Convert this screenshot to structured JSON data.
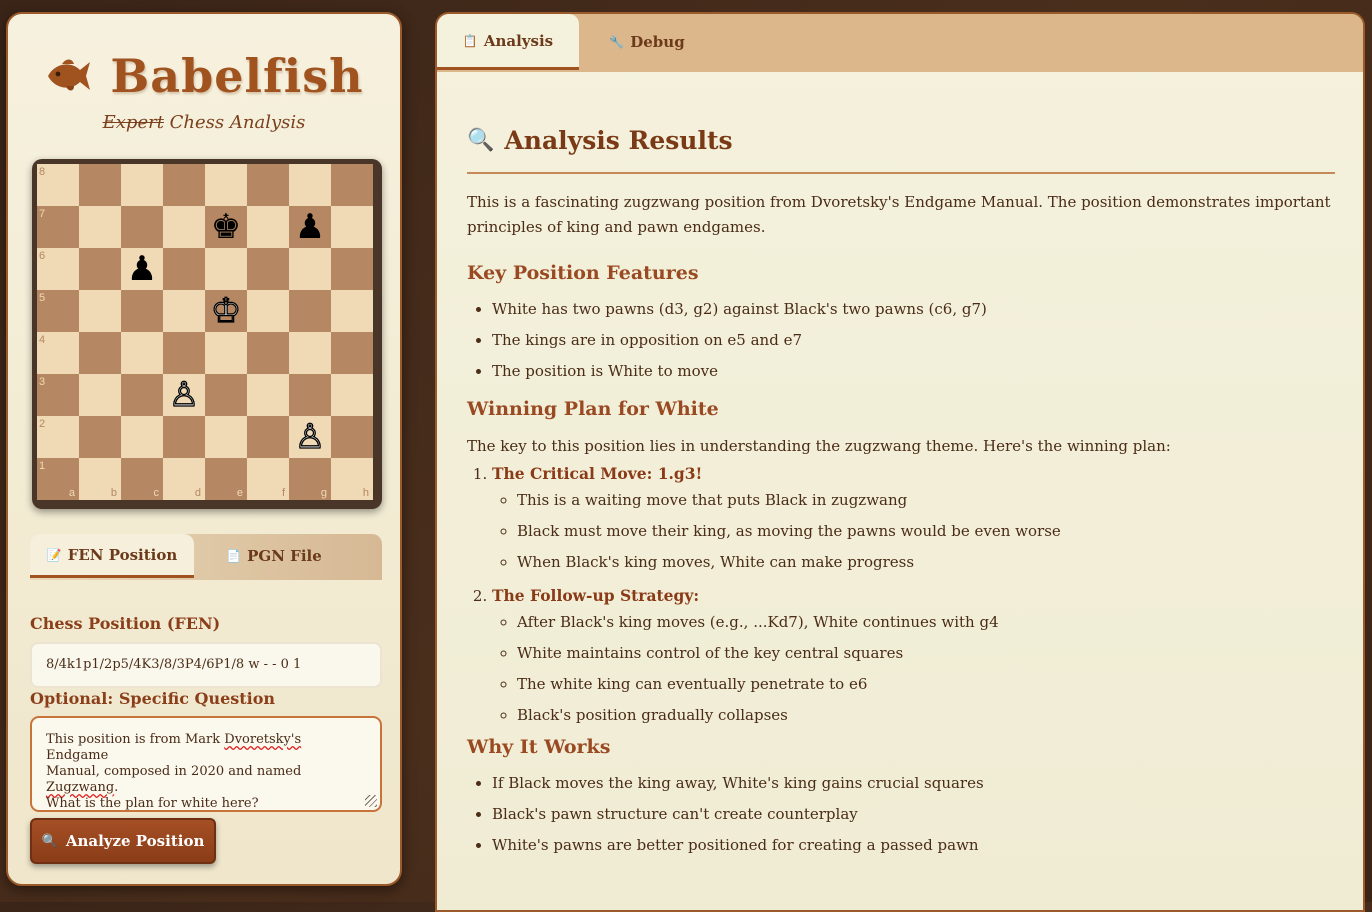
{
  "brand": {
    "title": "Babelfish",
    "subtitle_strike": "Expert",
    "subtitle_rest": " Chess Analysis"
  },
  "board": {
    "files": [
      "a",
      "b",
      "c",
      "d",
      "e",
      "f",
      "g",
      "h"
    ],
    "ranks": [
      "8",
      "7",
      "6",
      "5",
      "4",
      "3",
      "2",
      "1"
    ],
    "pieces": [
      {
        "square": "e7",
        "glyph": "♚",
        "color": "black"
      },
      {
        "square": "g7",
        "glyph": "♟",
        "color": "black"
      },
      {
        "square": "c6",
        "glyph": "♟",
        "color": "black"
      },
      {
        "square": "e5",
        "glyph": "♔",
        "color": "white"
      },
      {
        "square": "d3",
        "glyph": "♙",
        "color": "white"
      },
      {
        "square": "g2",
        "glyph": "♙",
        "color": "white"
      }
    ]
  },
  "input_tabs": [
    {
      "label": "FEN Position",
      "icon": "📝"
    },
    {
      "label": "PGN File",
      "icon": "📄"
    }
  ],
  "form": {
    "fen_label": "Chess Position (FEN)",
    "fen_value": "8/4k1p1/2p5/4K3/8/3P4/6P1/8 w - - 0 1",
    "question_label": "Optional: Specific Question",
    "question_parts": [
      "This position is from Mark ",
      "Dvoretsky's",
      " Endgame\nManual, composed in 2020 and named ",
      "Zugzwang",
      ".\nWhat is the plan for white here?"
    ],
    "analyze_label": "Analyze Position",
    "analyze_icon": "🔍"
  },
  "result_tabs": [
    {
      "label": "Analysis",
      "icon": "📋"
    },
    {
      "label": "Debug",
      "icon": "🔧"
    }
  ],
  "analysis": {
    "title": "Analysis Results",
    "title_icon": "🔍",
    "intro": "This is a fascinating zugzwang position from Dvoretsky's Endgame Manual. The position demonstrates important principles of king and pawn endgames.",
    "features_heading": "Key Position Features",
    "features": [
      "White has two pawns (d3, g2) against Black's two pawns (c6, g7)",
      "The kings are in opposition on e5 and e7",
      "The position is White to move"
    ],
    "plan_heading": "Winning Plan for White",
    "plan_intro": "The key to this position lies in understanding the zugzwang theme. Here's the winning plan:",
    "steps": [
      {
        "head": "The Critical Move: 1.g3!",
        "items": [
          "This is a waiting move that puts Black in zugzwang",
          "Black must move their king, as moving the pawns would be even worse",
          "When Black's king moves, White can make progress"
        ]
      },
      {
        "head": "The Follow-up Strategy:",
        "items": [
          "After Black's king moves (e.g., ...Kd7), White continues with g4",
          "White maintains control of the key central squares",
          "The white king can eventually penetrate to e6",
          "Black's position gradually collapses"
        ]
      }
    ],
    "why_heading": "Why It Works",
    "why": [
      "If Black moves the king away, White's king gains crucial squares",
      "Black's pawn structure can't create counterplay",
      "White's pawns are better positioned for creating a passed pawn"
    ]
  }
}
